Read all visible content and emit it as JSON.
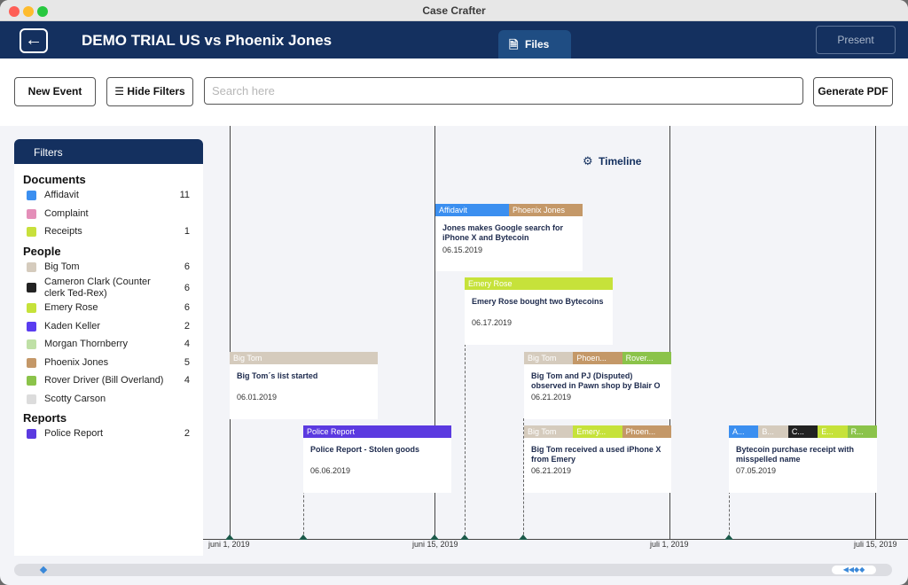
{
  "window": {
    "title": "Case Crafter"
  },
  "header": {
    "back_label": "←",
    "case_title": "DEMO TRIAL US vs Phoenix Jones",
    "tabs": [
      {
        "label": "Files"
      },
      {
        "label": "Timeline"
      }
    ],
    "present_label": "Present"
  },
  "toolbar": {
    "new_event": "New Event",
    "hide_filters": "Hide Filters",
    "search_placeholder": "Search here",
    "generate_pdf": "Generate PDF"
  },
  "filters": {
    "title": "Filters",
    "sections": [
      {
        "label": "Documents",
        "items": [
          {
            "label": "Affidavit",
            "count": "11",
            "color": "#3b8ff0"
          },
          {
            "label": "Complaint",
            "count": "",
            "color": "#e48fb9"
          },
          {
            "label": "Receipts",
            "count": "1",
            "color": "#c8e03c"
          }
        ]
      },
      {
        "label": "People",
        "items": [
          {
            "label": "Big Tom",
            "count": "6",
            "color": "#d5cbbd"
          },
          {
            "label": "Cameron Clark (Counter clerk Ted-Rex)",
            "count": "6",
            "color": "#222222"
          },
          {
            "label": "Emery Rose",
            "count": "6",
            "color": "#c6e23a"
          },
          {
            "label": "Kaden Keller",
            "count": "2",
            "color": "#5a3df0"
          },
          {
            "label": "Morgan Thornberry",
            "count": "4",
            "color": "#bfe0a6"
          },
          {
            "label": "Phoenix Jones",
            "count": "5",
            "color": "#c49868"
          },
          {
            "label": "Rover Driver (Bill Overland)",
            "count": "4",
            "color": "#8bc34a"
          },
          {
            "label": "Scotty Carson",
            "count": "",
            "color": "#dcdcdc"
          }
        ]
      },
      {
        "label": "Reports",
        "items": [
          {
            "label": "Police Report",
            "count": "2",
            "color": "#5b3ae0"
          }
        ]
      }
    ]
  },
  "timeline": {
    "axis_labels": [
      "juni 1, 2019",
      "juni 15, 2019",
      "juli 1, 2019",
      "juli 15, 2019"
    ],
    "events": [
      {
        "tags": [
          {
            "label": "Affidavit",
            "color": "#3b8ff0"
          },
          {
            "label": "Phoenix Jones",
            "color": "#c49868"
          }
        ],
        "title": "Jones makes Google search for iPhone X and Bytecoin",
        "date": "06.15.2019"
      },
      {
        "tags": [
          {
            "label": "Emery Rose",
            "color": "#c6e23a"
          }
        ],
        "title": "Emery Rose bought two Bytecoins",
        "date": "06.17.2019"
      },
      {
        "tags": [
          {
            "label": "Big Tom",
            "color": "#d5cbbd"
          }
        ],
        "title": "Big Tom´s list started",
        "date": "06.01.2019"
      },
      {
        "tags": [
          {
            "label": "Big Tom",
            "color": "#d5cbbd"
          },
          {
            "label": "Phoen...",
            "color": "#c49868"
          },
          {
            "label": "Rover...",
            "color": "#8bc34a"
          }
        ],
        "title": "Big Tom and PJ (Disputed) observed in Pawn shop by Blair O",
        "date": "06.21.2019"
      },
      {
        "tags": [
          {
            "label": "Police Report",
            "color": "#5b3ae0"
          }
        ],
        "title": "Police Report - Stolen goods",
        "date": "06.06.2019"
      },
      {
        "tags": [
          {
            "label": "Big Tom",
            "color": "#d5cbbd"
          },
          {
            "label": "Emery...",
            "color": "#c6e23a"
          },
          {
            "label": "Phoen...",
            "color": "#c49868"
          }
        ],
        "title": "Big Tom received a used iPhone X from Emery",
        "date": "06.21.2019"
      },
      {
        "tags": [
          {
            "label": "A...",
            "color": "#3b8ff0"
          },
          {
            "label": "B...",
            "color": "#d5cbbd"
          },
          {
            "label": "C...",
            "color": "#222222"
          },
          {
            "label": "E...",
            "color": "#c6e23a"
          },
          {
            "label": "R...",
            "color": "#8bc34a"
          }
        ],
        "title": "Bytecoin purchase receipt with misspelled name",
        "date": "07.05.2019"
      }
    ]
  }
}
